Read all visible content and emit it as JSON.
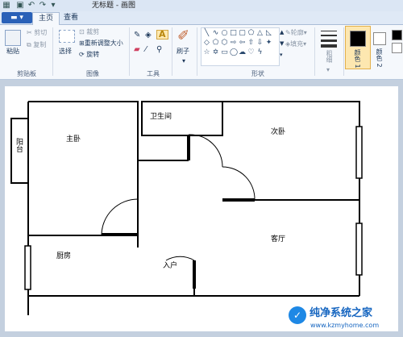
{
  "titlebar": {
    "title": "无标题 - 画图"
  },
  "tabs": {
    "file_label": "",
    "home": "主页",
    "view": "查看"
  },
  "clipboard": {
    "paste": "粘贴",
    "cut": "剪切",
    "copy": "复制",
    "group": "剪贴板"
  },
  "image": {
    "select": "选择",
    "crop": "裁剪",
    "resize": "重新调整大小",
    "rotate": "旋转",
    "group": "图像"
  },
  "tools": {
    "group": "工具"
  },
  "brushes": {
    "label": "刷子"
  },
  "shapes": {
    "outline": "轮廓",
    "fill": "填充",
    "group": "形状"
  },
  "size": {
    "label": "粗细"
  },
  "colors": {
    "color1": "颜色 1",
    "color2": "颜色 2",
    "color1_value": "#000000",
    "color2_value": "#ffffff"
  },
  "floorplan": {
    "rooms": {
      "balcony": "阳台",
      "master": "主卧",
      "bathroom": "卫生间",
      "second": "次卧",
      "kitchen": "厨房",
      "entrance": "入户",
      "living": "客厅"
    }
  },
  "watermark": {
    "title": "纯净系统之家",
    "url": "www.kzmyhome.com"
  }
}
